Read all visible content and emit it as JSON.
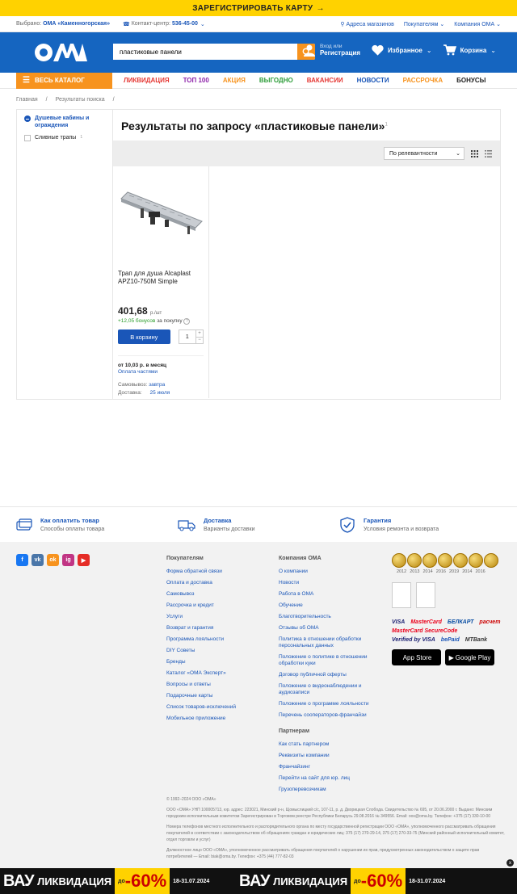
{
  "promo_bar": {
    "text": "ЗАРЕГИСТРИРОВАТЬ КАРТУ",
    "arrow": "→"
  },
  "info_bar": {
    "selected_label": "Выбрано:",
    "selected_store": "ОМА «Каменногорская»",
    "contact_label": "Контакт-центр:",
    "contact_phone": "536-45-00",
    "stores_link": "Адреса магазинов",
    "buyers_link": "Покупателям",
    "company_link": "Компания ОМА"
  },
  "header": {
    "logo_text": "ОМА",
    "search_value": "пластиковые панели",
    "login_top": "Вход или",
    "login_bottom": "Регистрация",
    "favorites": "Избранное",
    "cart": "Корзина"
  },
  "nav": {
    "catalog": "ВЕСЬ КАТАЛОГ",
    "items": [
      {
        "label": "ЛИКВИДАЦИЯ",
        "color": "#e53935"
      },
      {
        "label": "ТОП 100",
        "color": "#8e24aa"
      },
      {
        "label": "АКЦИЯ",
        "color": "#f7931e"
      },
      {
        "label": "ВЫГОДНО",
        "color": "#2e9d3a"
      },
      {
        "label": "ВАКАНСИИ",
        "color": "#e53935"
      },
      {
        "label": "НОВОСТИ",
        "color": "#1a56b8"
      },
      {
        "label": "РАССРОЧКА",
        "color": "#f7931e"
      },
      {
        "label": "БОНУСЫ",
        "color": "#222222"
      }
    ]
  },
  "breadcrumbs": {
    "home": "Главная",
    "current": "Результаты поиска"
  },
  "filters": [
    {
      "label": "Душевые кабины и ограждения",
      "count": "",
      "active": true
    },
    {
      "label": "Сливные трапы",
      "count": "1",
      "active": false
    }
  ],
  "results": {
    "title": "Результаты по запросу «пластиковые панели»",
    "title_count": "1",
    "sort": "По релевантности"
  },
  "product": {
    "name": "Трап для душа Alcaplast APZ10-750M Simple",
    "price": "401,68",
    "price_unit": "р./шт",
    "bonus": "+12,05 бонусов",
    "bonus_suffix": "за покупку",
    "cart_button": "В корзину",
    "qty": "1",
    "installment_prefix": "от 10,03 р. в месяц",
    "installment_link": "Оплата частями",
    "pickup_label": "Самовывоз:",
    "pickup_value": "завтра",
    "delivery_label": "Доставка:",
    "delivery_value": "25 июля"
  },
  "features": [
    {
      "title": "Как оплатить товар",
      "subtitle": "Способы оплаты товара"
    },
    {
      "title": "Доставка",
      "subtitle": "Варианты доставки"
    },
    {
      "title": "Гарантия",
      "subtitle": "Условия ремонта и возврата"
    }
  ],
  "footer": {
    "socials": [
      {
        "label": "f",
        "color": "#1877f2"
      },
      {
        "label": "vk",
        "color": "#4a76a8"
      },
      {
        "label": "ok",
        "color": "#f7931e"
      },
      {
        "label": "ig",
        "color": "#c13584"
      },
      {
        "label": "▶",
        "color": "#e52d27"
      }
    ],
    "buyers_title": "Покупателям",
    "buyers_links": [
      "Форма обратной связи",
      "Оплата и доставка",
      "Самовывоз",
      "Рассрочка и кредит",
      "Услуги",
      "Возврат и гарантия",
      "Программа лояльности",
      "DIY Советы",
      "Бренды",
      "Каталог «ОМА Эксперт»",
      "Вопросы и ответы",
      "Подарочные карты",
      "Список товаров-исключений",
      "Мобильное приложение"
    ],
    "company_title": "Компания ОМА",
    "company_links": [
      "О компании",
      "Новости",
      "Работа в ОМА",
      "Обучение",
      "Благотворительность",
      "Отзывы об ОМА",
      "Политика в отношении обработки персональных данных",
      "Положение о политике в отношении обработки куки",
      "Договор публичной оферты",
      "Положение о видеонаблюдении и аудиозаписи",
      "Положение о программе лояльности",
      "Перечень сооператоров-франчайзи"
    ],
    "partners_title": "Партнерам",
    "partners_links": [
      "Как стать партнером",
      "Реквизиты компании",
      "Франчайзинг",
      "Перейти на сайт для юр. лиц",
      "Грузоперевозчикам"
    ],
    "medal_years": [
      "2012",
      "2013",
      "2014",
      "2016",
      "2019",
      "2014",
      "2016"
    ],
    "payments": [
      {
        "label": "VISA",
        "color": "#1a1f71"
      },
      {
        "label": "MasterCard",
        "color": "#eb001b"
      },
      {
        "label": "БЕЛКАРТ",
        "color": "#0a4ea3"
      },
      {
        "label": "расчет",
        "color": "#c00"
      },
      {
        "label": "MasterCard SecureCode",
        "color": "#eb001b"
      },
      {
        "label": "Verified by VISA",
        "color": "#1a1f71"
      },
      {
        "label": "bePaid",
        "color": "#1a56b8"
      },
      {
        "label": "MTBank",
        "color": "#333"
      }
    ],
    "app_store": "App Store",
    "google_play": "Google Play",
    "copyright": "© 1992–2024 ООО «ОМА»",
    "legal1": "ООО «ОМА» УНП 100005713, юр. адрес: 223021, Минский р-н, Щомыслицкий с/с, 107-11, р. д. Дворицкая Слобода. Свидетельство № 695, от 20.06.2000 г. Выдано: Минским городским исполнительным комитетом Зарегистрирован в Торговом реестре Республики Беларусь 29.08.2016 № 349556. Email: oos@oma.by. Телефон: +375 (17) 330-10-00",
    "legal2": "Номера телефонов местного исполнительного и распорядительного органа по месту государственной регистрации ООО «ОМА», уполномоченного рассматривать обращения покупателей в соответствии с законодательством об обращениях граждан и юридических лиц: 375 (17) 270-29-14, 375 (17) 270-33-75 (Минский районный исполнительный комитет, отдел торговли и услуг)",
    "legal3": "Должностное лицо ООО «ОМА», уполномоченное рассматривать обращения покупателей о нарушении их прав, предусмотренных законодательством о защите прав потребителей — Email: biak@oma.by. Телефон: +375 (44) 777-82-03"
  },
  "banner": {
    "text1": "ВАУ",
    "text2": "ЛИКВИДАЦИЯ",
    "prefix": "до",
    "percent": "-60%",
    "dates": "18-31.07.2024",
    "close": "x"
  }
}
